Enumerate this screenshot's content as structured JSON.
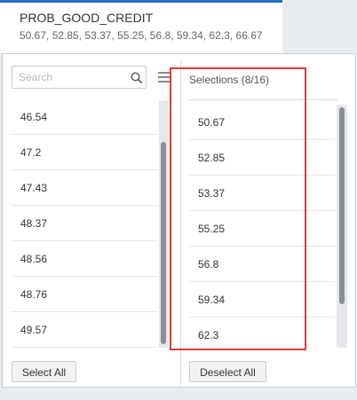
{
  "tab": {
    "title": "PROB_GOOD_CREDIT",
    "values_summary": "50.67, 52.85, 53.37, 55.25, 56.8, 59.34, 62.3, 66.67"
  },
  "search": {
    "placeholder": "Search",
    "icon": "search-icon"
  },
  "menu": {
    "icon": "hamburger-menu-icon"
  },
  "available": {
    "items": [
      "46.54",
      "47.2",
      "47.43",
      "48.37",
      "48.56",
      "48.76",
      "49.57"
    ],
    "button_label": "Select All"
  },
  "selections": {
    "header": "Selections (8/16)",
    "items": [
      "50.67",
      "52.85",
      "53.37",
      "55.25",
      "56.8",
      "59.34",
      "62.3"
    ],
    "button_label": "Deselect All"
  },
  "colors": {
    "tab_accent": "#2d6ec6",
    "highlight_border": "#e53935"
  }
}
